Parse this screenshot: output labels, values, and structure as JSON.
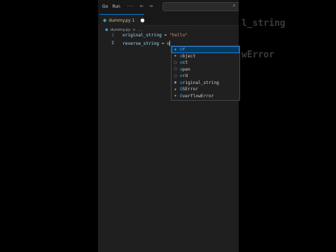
{
  "menubar": {
    "go": "Go",
    "run": "Run",
    "more": "···",
    "back": "←",
    "forward": "→"
  },
  "tab": {
    "filename": "dummy.py",
    "problems": "1",
    "modified": "●"
  },
  "breadcrumb": {
    "file": "dummy.py",
    "chevron": ">",
    "more": "..."
  },
  "code": [
    {
      "num": "1",
      "var": "original_string",
      "op": " = ",
      "val": "\"hello\""
    },
    {
      "num": "2",
      "var": "reverse_string",
      "op": " = ",
      "typed": "o"
    }
  ],
  "suggestions": [
    {
      "match": "o",
      "rest": "r",
      "kind": "class",
      "icon": "class-icon"
    },
    {
      "match": "o",
      "rest": "bject",
      "kind": "class",
      "icon": "class-icon"
    },
    {
      "match": "o",
      "rest": "ct",
      "kind": "func",
      "icon": "function-icon"
    },
    {
      "match": "o",
      "rest": "pen",
      "kind": "func",
      "icon": "function-icon"
    },
    {
      "match": "o",
      "rest": "rd",
      "kind": "func",
      "icon": "function-icon"
    },
    {
      "match": "o",
      "rest": "riginal_string",
      "kind": "var",
      "icon": "variable-icon"
    },
    {
      "match": "O",
      "rest": "SError",
      "kind": "class",
      "icon": "class-icon"
    },
    {
      "match": "O",
      "rest": "verflowError",
      "kind": "class",
      "icon": "class-icon"
    }
  ],
  "background": {
    "right_top": "l_string",
    "right_mid": "wError"
  },
  "colors": {
    "accent": "#0078d4",
    "selection": "#04395e",
    "string": "#ce9178",
    "variable": "#9cdcfe"
  }
}
